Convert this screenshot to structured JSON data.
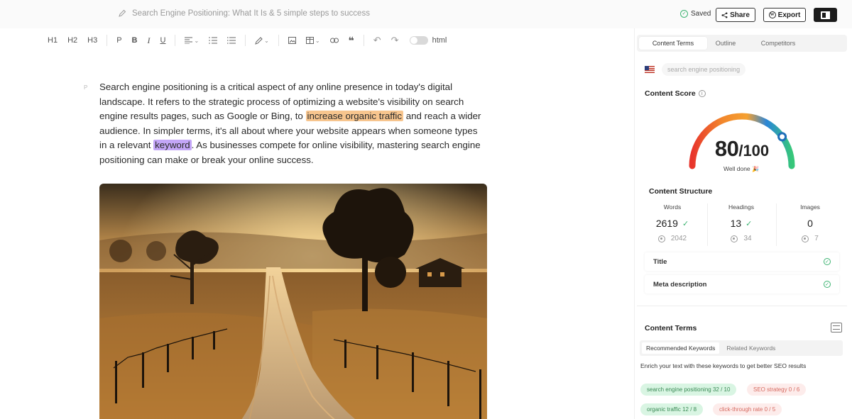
{
  "header": {
    "doc_title": "Search Engine Positioning: What It Is & 5 simple steps to success",
    "saved_label": "Saved",
    "share_label": "Share",
    "export_label": "Export"
  },
  "toolbar": {
    "h1": "H1",
    "h2": "H2",
    "h3": "H3",
    "p": "P",
    "bold": "B",
    "italic": "I",
    "underline": "U",
    "html_label": "html"
  },
  "editor": {
    "paragraph_marker": "P",
    "t1": "Search engine positioning is a critical aspect of any online presence in today's digital landscape. It refers to the strategic process of optimizing a website's visibility on search engine results pages, such as Google or Bing, to ",
    "h1": "increase organic traffic",
    "t2": " and reach a wider audience. In simpler terms, it's all about where your website appears when someone types in a relevant ",
    "h2": "keyword",
    "t3": ". As businesses compete for online visibility, mastering search engine positioning can make or break your online success."
  },
  "panel": {
    "tabs": [
      "Content Terms",
      "Outline",
      "Competitors"
    ],
    "keyword": "search engine positioning",
    "content_score": {
      "title": "Content Score",
      "score": "80",
      "max": "/100",
      "verdict": "Well done",
      "value_fraction": 0.8
    },
    "structure": {
      "title": "Content Structure",
      "stats": [
        {
          "label": "Words",
          "value": "2619",
          "target": "2042",
          "ok": true
        },
        {
          "label": "Headings",
          "value": "13",
          "target": "34",
          "ok": true
        },
        {
          "label": "Images",
          "value": "0",
          "target": "7",
          "ok": false
        }
      ],
      "checks": [
        "Title",
        "Meta description"
      ]
    },
    "terms": {
      "title": "Content Terms",
      "subtabs": [
        "Recommended Keywords",
        "Related Keywords"
      ],
      "description": "Enrich your text with these keywords to get better SEO results",
      "pills": [
        {
          "text": "search engine positioning 32 / 10",
          "status": "green"
        },
        {
          "text": "SEO strategy 0 / 6",
          "status": "red"
        },
        {
          "text": "organic traffic 12 / 8",
          "status": "green"
        },
        {
          "text": "click-through rate 0 / 5",
          "status": "red"
        }
      ]
    }
  },
  "colors": {
    "accent_green": "#3cb371",
    "highlight_orange": "#f7c58e",
    "highlight_purple": "#c3a6f7"
  }
}
